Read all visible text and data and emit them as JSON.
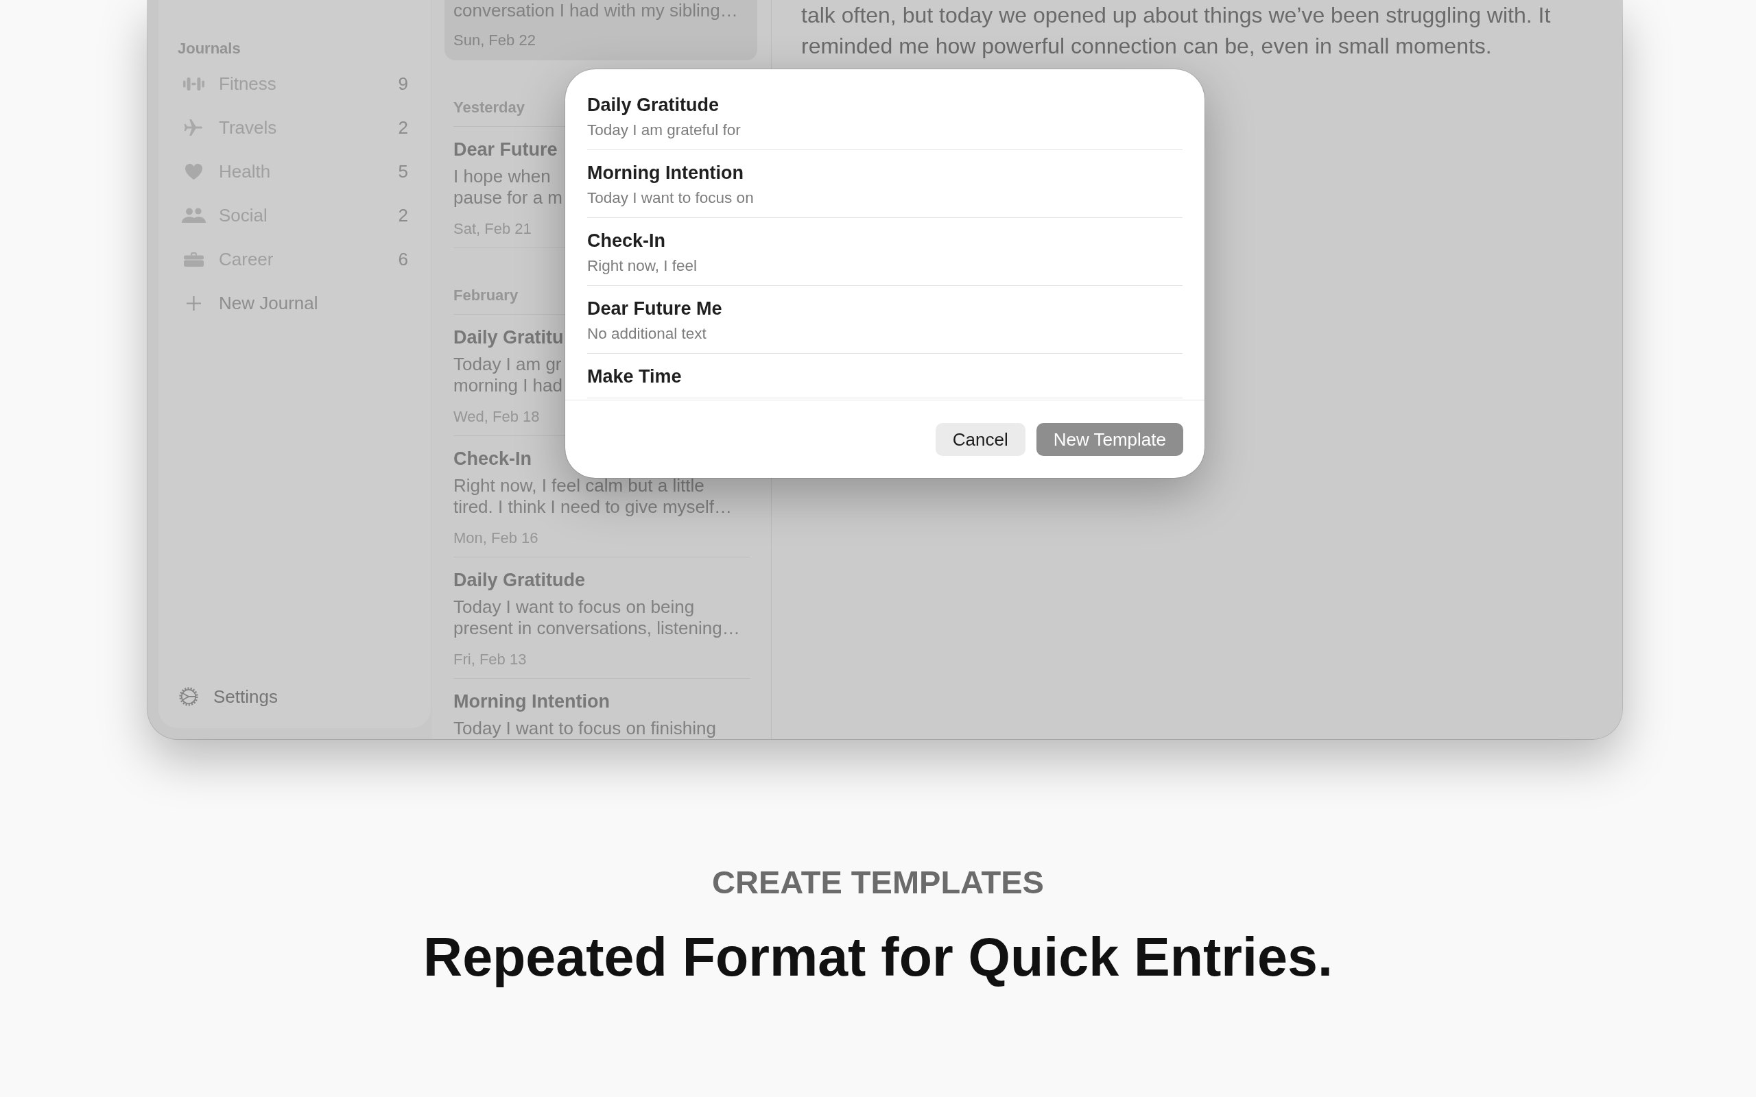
{
  "sidebar": {
    "journals_header": "Journals",
    "journals": [
      {
        "name": "Fitness",
        "count": "9"
      },
      {
        "name": "Travels",
        "count": "2"
      },
      {
        "name": "Health",
        "count": "5"
      },
      {
        "name": "Social",
        "count": "2"
      },
      {
        "name": "Career",
        "count": "6"
      }
    ],
    "new_journal": "New Journal",
    "settings": "Settings"
  },
  "entry_list": {
    "sections": [
      {
        "entries": [
          {
            "preview_lines": [
              "conversation I had with my sibling…"
            ],
            "date": "Sun, Feb 22",
            "selected": true
          }
        ]
      },
      {
        "header": "Yesterday",
        "entries": [
          {
            "title": "Dear Future",
            "preview_lines": [
              "I hope when",
              "pause for a m"
            ],
            "date": "Sat, Feb 21",
            "selected": false
          }
        ]
      },
      {
        "header": "February",
        "entries": [
          {
            "title": "Daily Gratitu",
            "preview_lines": [
              "Today I am gr",
              "morning I had"
            ],
            "date": "Wed, Feb 18",
            "selected": false
          },
          {
            "title": "Check-In",
            "preview_lines": [
              "Right now, I feel calm but a little",
              "tired. I think I need to give myself…"
            ],
            "date": "Mon, Feb 16",
            "selected": false
          },
          {
            "title": "Daily Gratitude",
            "preview_lines": [
              "Today I want to focus on being",
              "present in conversations, listening…"
            ],
            "date": "Fri, Feb 13",
            "selected": false
          },
          {
            "title": "Morning Intention",
            "preview_lines": [
              "Today I want to focus on finishing"
            ],
            "selected": false
          }
        ]
      }
    ]
  },
  "entry_view": {
    "body_lines": [
      "talk often, but today we opened up about things we’ve been struggling with. It",
      "reminded me how powerful connection can be, even in small moments."
    ]
  },
  "template_dialog": {
    "templates": [
      {
        "title": "Daily Gratitude",
        "text": "Today I am grateful for"
      },
      {
        "title": "Morning Intention",
        "text": "Today I want to focus on"
      },
      {
        "title": "Check-In",
        "text": "Right now, I feel"
      },
      {
        "title": "Dear Future Me",
        "text": "No additional text"
      },
      {
        "title": "Make Time"
      }
    ],
    "buttons": [
      {
        "label": "Cancel",
        "kind": "cancel"
      },
      {
        "label": "New Template",
        "kind": "default"
      }
    ]
  },
  "caption": {
    "eyebrow": "CREATE TEMPLATES",
    "headline": "Repeated Format for Quick Entries."
  }
}
